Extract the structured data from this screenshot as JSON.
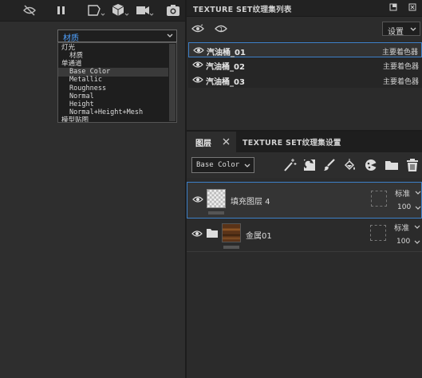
{
  "viewport": {
    "toolbar_icons": [
      "hide-icon",
      "pause-icon",
      "camera-view-icon",
      "cube-icon",
      "video-camera-icon",
      "screenshot-icon"
    ],
    "channel_dropdown": {
      "selected": "材质",
      "items": [
        "灯光",
        "材质",
        "单通道",
        "Base Color",
        "Metallic",
        "Roughness",
        "Normal",
        "Height",
        "Normal+Height+Mesh",
        "模型贴图"
      ],
      "highlighted": "Base Color"
    }
  },
  "texture_set_list": {
    "title": "TEXTURE SET纹理集列表",
    "settings_label": "设置",
    "items": [
      {
        "name": "汽油桶_01",
        "shader": "主要着色器",
        "active": true
      },
      {
        "name": "汽油桶_02",
        "shader": "主要着色器",
        "active": false
      },
      {
        "name": "汽油桶_03",
        "shader": "主要着色器",
        "active": false
      }
    ]
  },
  "layers_panel": {
    "tab_layers": "图层",
    "tab_texture_set_settings": "TEXTURE SET纹理集设置",
    "channel_select": "Base Color",
    "layers": [
      {
        "name": "填充图层 4",
        "blend": "标准",
        "opacity": "100",
        "active": true,
        "thumb": "checker"
      },
      {
        "name": "金属01",
        "blend": "标准",
        "opacity": "100",
        "active": false,
        "thumb": "rust"
      }
    ],
    "accent": "#3d80c8"
  }
}
